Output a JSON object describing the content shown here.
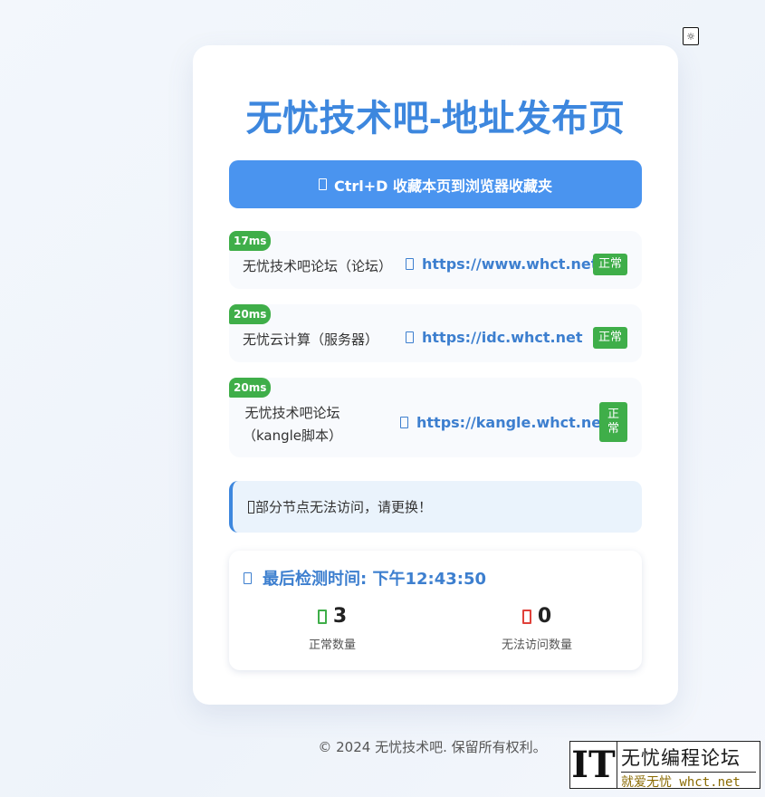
{
  "page": {
    "title": "无忧技术吧-地址发布页",
    "bookmark_button": "Ctrl+D 收藏本页到浏览器收藏夹"
  },
  "links": [
    {
      "latency": "17ms",
      "name": "无忧技术吧论坛（论坛）",
      "url": "https://www.whct.net",
      "status": "正常"
    },
    {
      "latency": "20ms",
      "name": "无忧云计算（服务器）",
      "url": "https://idc.whct.net",
      "status": "正常"
    },
    {
      "latency": "20ms",
      "name_line1": "无忧技术吧论坛",
      "name_line2": "（kangle脚本）",
      "url": "https://kangle.whct.net",
      "status_line1": "正",
      "status_line2": "常"
    }
  ],
  "notice": "部分节点无法访问，请更换！",
  "stats": {
    "check_time": "最后检测时间: 下午12:43:50",
    "ok_count": "3",
    "ok_label": "正常数量",
    "bad_count": "0",
    "bad_label": "无法访问数量"
  },
  "footer": "© 2024 无忧技术吧. 保留所有权利。",
  "watermark": {
    "it": "IT",
    "line1": "无忧编程论坛",
    "line2": "就爱无忧 whct.net"
  },
  "colors": {
    "accent": "#3d87de",
    "button": "#4a94ef",
    "ok": "#3fae49",
    "bad": "#e0413a"
  }
}
